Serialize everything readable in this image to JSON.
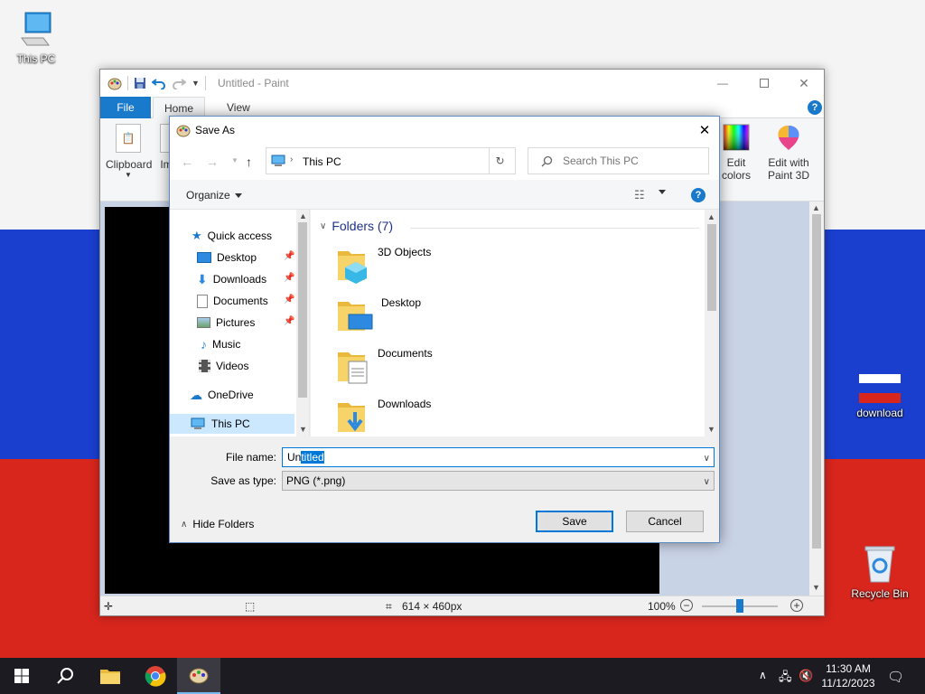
{
  "desktop": {
    "icons": [
      {
        "label": "This PC"
      },
      {
        "label": "download"
      },
      {
        "label": "Recycle Bin"
      }
    ]
  },
  "paint": {
    "title": "Untitled - Paint",
    "tabs": {
      "file": "File",
      "home": "Home",
      "view": "View"
    },
    "help": "?",
    "ribbon": {
      "clipboard": "Clipboard",
      "image_partial": "Im",
      "edit_colors": [
        "Edit",
        "colors"
      ],
      "edit_paint3d": [
        "Edit with",
        "Paint 3D"
      ]
    },
    "status": {
      "dimensions": "614 × 460px",
      "zoom": "100%",
      "zoom_fraction": 0.5
    }
  },
  "dialog": {
    "title": "Save As",
    "address": "This PC",
    "search_placeholder": "Search This PC",
    "organize": "Organize",
    "help": "?",
    "nav": [
      {
        "label": "Quick access"
      },
      {
        "label": "Desktop"
      },
      {
        "label": "Downloads"
      },
      {
        "label": "Documents"
      },
      {
        "label": "Pictures"
      },
      {
        "label": "Music"
      },
      {
        "label": "Videos"
      },
      {
        "label": "OneDrive"
      },
      {
        "label": "This PC"
      }
    ],
    "group_header": "Folders (7)",
    "folders": [
      {
        "name": "3D Objects"
      },
      {
        "name": "Desktop"
      },
      {
        "name": "Documents"
      },
      {
        "name": "Downloads"
      }
    ],
    "file_name_label": "File name:",
    "file_name_prefix": "Un",
    "file_name_selected": "titled",
    "save_as_type_label": "Save as type:",
    "save_as_type": "PNG (*.png)",
    "hide_folders": "Hide Folders",
    "save_label": "Save",
    "cancel_label": "Cancel"
  },
  "taskbar": {
    "time": "11:30 AM",
    "date": "11/12/2023"
  }
}
